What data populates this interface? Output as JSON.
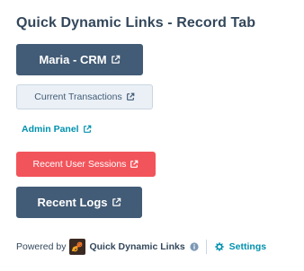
{
  "card": {
    "title": "Quick Dynamic Links - Record Tab"
  },
  "links": [
    {
      "label": "Maria - CRM",
      "style": "primary-large"
    },
    {
      "label": "Current Transactions",
      "style": "secondary-small"
    },
    {
      "label": "Admin Panel",
      "style": "link"
    },
    {
      "label": "Recent User Sessions",
      "style": "danger-small"
    },
    {
      "label": "Recent Logs",
      "style": "primary-medium"
    }
  ],
  "footer": {
    "powered_by": "Powered by",
    "brand": "Quick Dynamic Links",
    "settings_label": "Settings"
  },
  "colors": {
    "primary": "#425b76",
    "secondary_bg": "#eaf0f6",
    "link": "#0091ae",
    "danger": "#f2545b",
    "text": "#33475b"
  },
  "icons": {
    "external": "external-link-icon",
    "info": "info-icon",
    "settings": "gear-icon",
    "brand_logo": "quick-dynamic-links-logo"
  }
}
